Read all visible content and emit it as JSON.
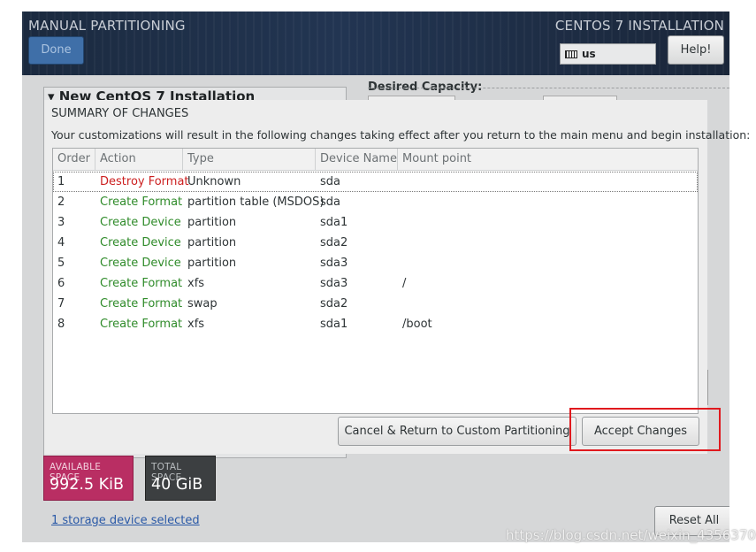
{
  "window": {
    "title_left": "MANUAL PARTITIONING",
    "title_right": "CENTOS 7 INSTALLATION",
    "done_label": "Done",
    "help_label": "Help!",
    "keyboard_layout": "us"
  },
  "background": {
    "left_panel_title": "▾ New CentOS 7 Installation",
    "desired_capacity_label": "Desired Capacity:",
    "available_space_label": "AVAILABLE SPACE",
    "available_space_value": "992.5 KiB",
    "total_space_label": "TOTAL SPACE",
    "total_space_value": "40 GiB",
    "storage_link": "1 storage device selected",
    "reset_label": "Reset All"
  },
  "dialog": {
    "title": "SUMMARY OF CHANGES",
    "description": "Your customizations will result in the following changes taking effect after you return to the main menu and begin installation:",
    "columns": [
      "Order",
      "Action",
      "Type",
      "Device Name",
      "Mount point"
    ],
    "rows": [
      {
        "order": "1",
        "action": "Destroy Format",
        "type": "Unknown",
        "device": "sda",
        "mount": ""
      },
      {
        "order": "2",
        "action": "Create Format",
        "type": "partition table (MSDOS)",
        "device": "sda",
        "mount": ""
      },
      {
        "order": "3",
        "action": "Create Device",
        "type": "partition",
        "device": "sda1",
        "mount": ""
      },
      {
        "order": "4",
        "action": "Create Device",
        "type": "partition",
        "device": "sda2",
        "mount": ""
      },
      {
        "order": "5",
        "action": "Create Device",
        "type": "partition",
        "device": "sda3",
        "mount": ""
      },
      {
        "order": "6",
        "action": "Create Format",
        "type": "xfs",
        "device": "sda3",
        "mount": "/"
      },
      {
        "order": "7",
        "action": "Create Format",
        "type": "swap",
        "device": "sda2",
        "mount": ""
      },
      {
        "order": "8",
        "action": "Create Format",
        "type": "xfs",
        "device": "sda1",
        "mount": "/boot"
      }
    ],
    "cancel_label": "Cancel & Return to Custom Partitioning",
    "accept_label": "Accept Changes"
  },
  "watermark": "https://blog.csdn.net/weixin_43563705",
  "colors": {
    "destroy_action": "#cc1f1f",
    "create_action": "#2f8b2a",
    "available_space_bg": "#b92e63",
    "highlight_outline": "#e0191e"
  }
}
